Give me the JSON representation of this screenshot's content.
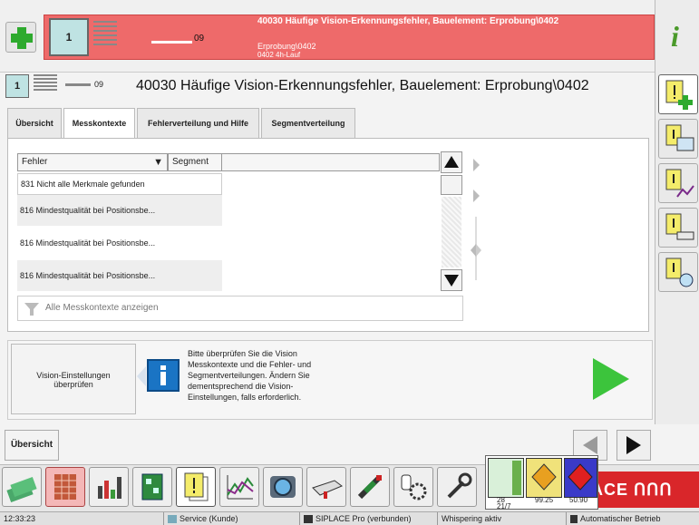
{
  "header": {
    "count": "1",
    "progress_label": "09",
    "alarm_title": "40030 Häufige Vision-Erkennungsfehler, Bauelement: Erprobung\\0402",
    "alarm_line2": "Erprobung\\0402",
    "alarm_line3": "0402 4h-Lauf"
  },
  "title_row": {
    "count": "1",
    "progress_label": "09",
    "title": "40030 Häufige Vision-Erkennungsfehler, Bauelement: Erprobung\\0402"
  },
  "tabs": [
    {
      "label": "Übersicht"
    },
    {
      "label": "Messkontexte",
      "active": true
    },
    {
      "label": "Fehlerverteilung und Hilfe"
    },
    {
      "label": "Segmentverteilung"
    }
  ],
  "table": {
    "col_fehler": "Fehler",
    "col_segment": "Segment",
    "rows": [
      {
        "fehler": "831 Nicht alle Merkmale gefunden",
        "segment": ""
      },
      {
        "fehler": "816 Mindestqualität bei Positionsbe...",
        "segment": ""
      },
      {
        "fehler": "816 Mindestqualität bei Positionsbe...",
        "segment": ""
      },
      {
        "fehler": "816 Mindestqualität bei Positionsbe...",
        "segment": ""
      }
    ]
  },
  "filter": {
    "label": "Alle Messkontexte anzeigen"
  },
  "info": {
    "button_label_1": "Vision-Einstellungen",
    "button_label_2": "überprüfen",
    "lines": [
      "Bitte überprüfen Sie die Vision",
      "Messkontexte und die Fehler- und",
      "Segmentverteilungen. Ändern Sie",
      "dementsprechend die Vision-",
      "Einstellungen, falls erforderlich."
    ]
  },
  "nav": {
    "ubersicht": "Übersicht"
  },
  "gauges": [
    {
      "value": "28",
      "sub": "21/7"
    },
    {
      "value": "99.25",
      "sub": ""
    },
    {
      "value": "50.90",
      "sub": ""
    }
  ],
  "logo": "ACE ՈՈՈ",
  "status": {
    "time": "12:33:23",
    "service": "Service (Kunde)",
    "pro": "SIPLACE Pro (verbunden)",
    "whisper": "Whispering aktiv",
    "mode": "Automatischer Betrieb"
  },
  "colors": {
    "alarm": "#ee6a6a",
    "accent_green": "#3cc43c",
    "siplace_red": "#d9262a"
  }
}
